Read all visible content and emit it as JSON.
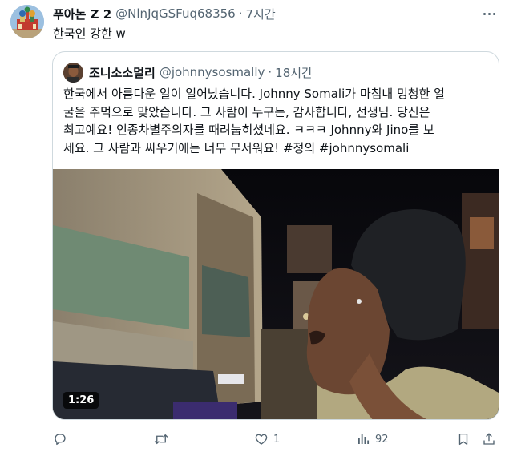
{
  "tweet": {
    "author_name": "푸아논 Z 2",
    "author_handle": "@NlnJqGSFuq68356",
    "separator": "·",
    "time": "7시간",
    "text": "한국인 강한 w"
  },
  "quote": {
    "author_name": "조니소소멀리",
    "author_handle": "@johnnysosmally",
    "separator": "·",
    "time": "18시간",
    "text_lines": [
      "한국에서 아름다운 일이 일어났습니다. Johnny Somali가 마침내 멍청한 얼",
      "굴을 주먹으로 맞았습니다. 그 사람이 누구든, 감사합니다, 선생님. 당신은",
      "최고예요! 인종차별주의자를 때려눕히셨네요. ㅋㅋㅋ Johnny와 Jino를 보",
      "세요. 그 사람과 싸우기에는 너무 무서워요! #정의 #johnnysomali"
    ],
    "video_duration": "1:26"
  },
  "actions": {
    "reply_count": "",
    "retweet_count": "",
    "like_count": "1",
    "views_count": "92"
  },
  "colors": {
    "text_primary": "#0f1419",
    "text_secondary": "#536471",
    "border": "#cfd9de"
  },
  "icons": [
    "reply-icon",
    "retweet-icon",
    "like-icon",
    "views-icon",
    "bookmark-icon",
    "share-icon",
    "more-icon"
  ]
}
